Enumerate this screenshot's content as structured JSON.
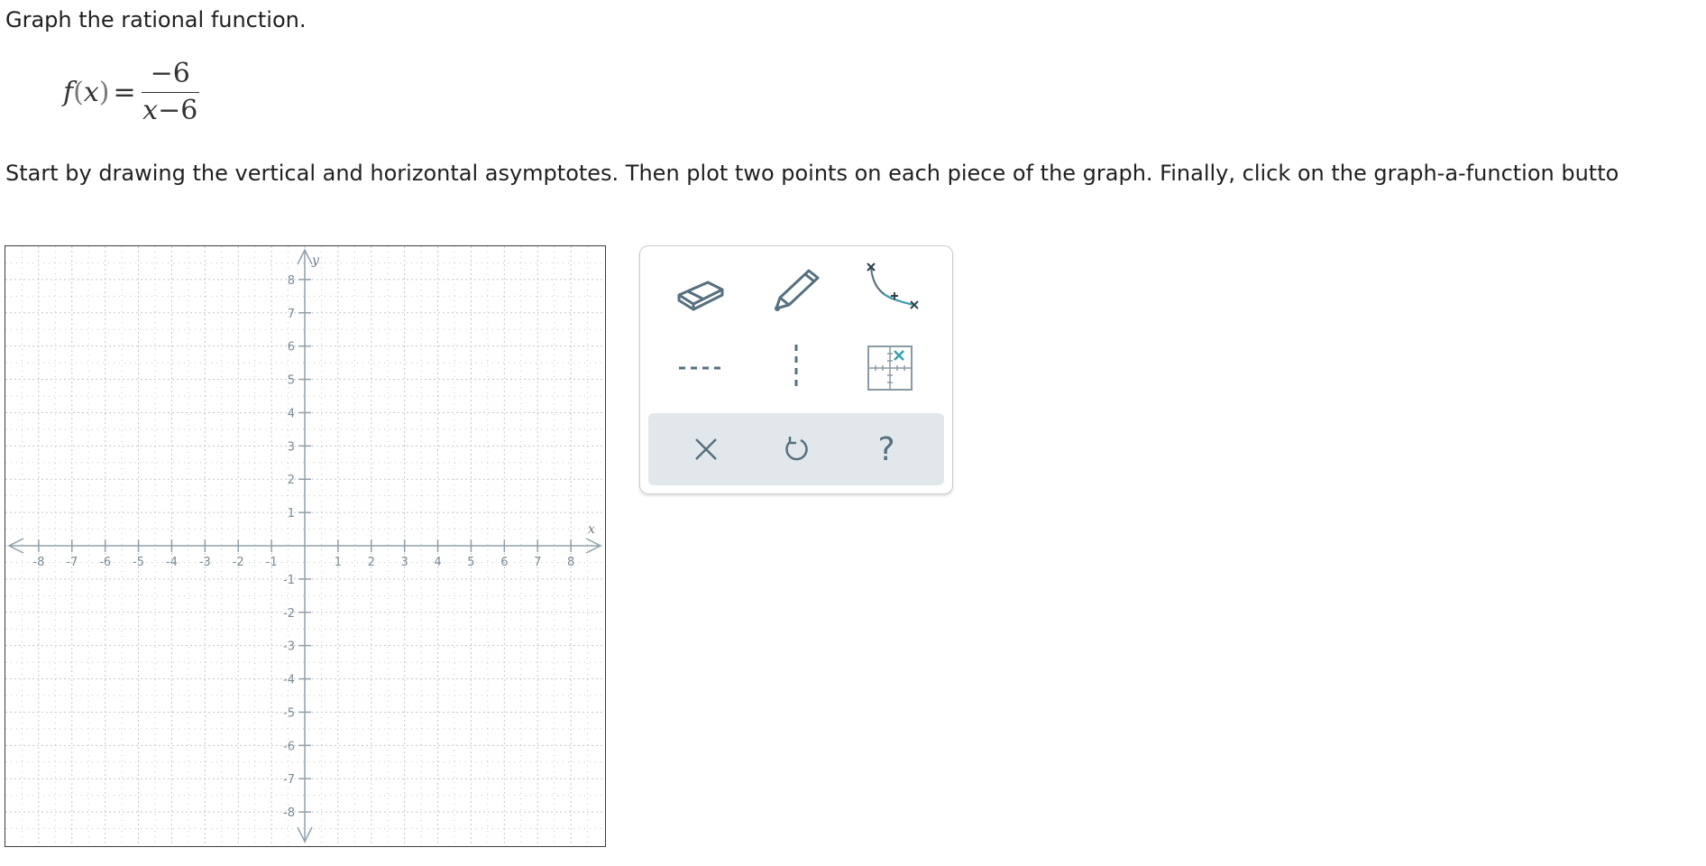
{
  "prompt": "Graph the rational function.",
  "formula": {
    "function_name": "f",
    "variable": "x",
    "equals": "=",
    "numerator": "−6",
    "denominator_var": "x",
    "denominator_rest": "−6"
  },
  "instructions": "Start by drawing the vertical and horizontal asymptotes. Then plot two points on each piece of the graph. Finally, click on the graph-a-function butto",
  "graph": {
    "x_axis_label": "x",
    "y_axis_label": "y",
    "x_min": -9,
    "x_max": 9,
    "y_min": -9,
    "y_max": 9,
    "x_tick_labels": [
      "-8",
      "-7",
      "-6",
      "-5",
      "-4",
      "-3",
      "-2",
      "-1",
      "1",
      "2",
      "3",
      "4",
      "5",
      "6",
      "7",
      "8"
    ],
    "y_tick_labels": [
      "8",
      "7",
      "6",
      "5",
      "4",
      "3",
      "2",
      "1",
      "-1",
      "-2",
      "-3",
      "-4",
      "-5",
      "-6",
      "-7",
      "-8"
    ],
    "grid": "dotted",
    "colors": {
      "axis": "#8fa0aa",
      "grid": "#bfc8ce",
      "border": "#3d3d3d"
    }
  },
  "toolbar": {
    "tools": [
      {
        "name": "eraser-icon"
      },
      {
        "name": "pencil-icon"
      },
      {
        "name": "graph-a-function-icon"
      },
      {
        "name": "horizontal-asymptote-icon"
      },
      {
        "name": "vertical-asymptote-icon"
      },
      {
        "name": "point-grid-icon"
      }
    ],
    "actions": [
      {
        "name": "clear-icon"
      },
      {
        "name": "undo-icon"
      },
      {
        "name": "help-icon",
        "glyph": "?"
      }
    ],
    "colors": {
      "icon": "#56707f",
      "accent": "#3aa0b0",
      "action_bar_bg": "#e2e7eb"
    }
  }
}
